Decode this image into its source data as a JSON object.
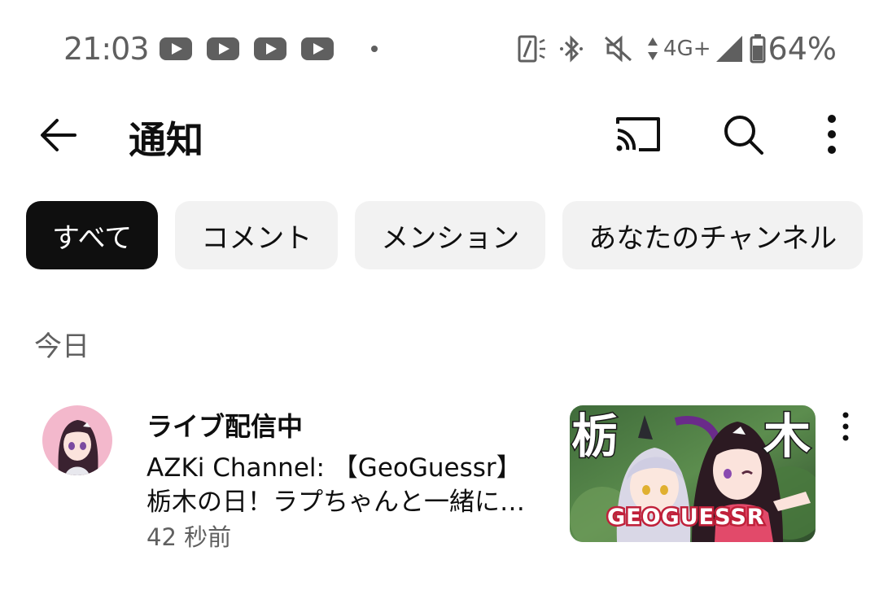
{
  "status_bar": {
    "time": "21:03",
    "notification_icons": [
      "youtube-icon",
      "youtube-icon",
      "youtube-icon",
      "youtube-icon"
    ],
    "network": "4G+",
    "battery": "64%"
  },
  "header": {
    "title": "通知"
  },
  "chips": [
    {
      "label": "すべて",
      "selected": true
    },
    {
      "label": "コメント",
      "selected": false
    },
    {
      "label": "メンション",
      "selected": false
    },
    {
      "label": "あなたのチャンネル",
      "selected": false
    }
  ],
  "sections": [
    {
      "label": "今日",
      "items": [
        {
          "heading": "ライブ配信中",
          "body": "AZKi Channel: 【GeoGuessr】栃木の日！ラプちゃんと一緒に栃木をめぐる",
          "time": "42 秒前",
          "thumbnail": {
            "left_text": "栃",
            "right_text": "木",
            "logo_text": "GEOGUESSR"
          }
        }
      ]
    }
  ],
  "colors": {
    "text_primary": "#0f0f0f",
    "text_secondary": "#606060",
    "chip_bg": "#f2f2f2",
    "chip_active_bg": "#0f0f0f",
    "status_gray": "#5f5f5f"
  }
}
